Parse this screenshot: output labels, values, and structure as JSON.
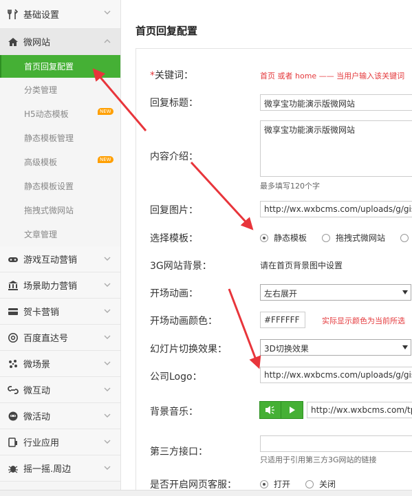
{
  "sidebar": {
    "groups_top": [
      {
        "label": "基础设置",
        "icon": "tools-icon"
      },
      {
        "label": "微网站",
        "icon": "home-icon"
      }
    ],
    "sub_items": [
      {
        "label": "首页回复配置",
        "active": true,
        "new": false
      },
      {
        "label": "分类管理",
        "active": false,
        "new": false
      },
      {
        "label": "H5动态模板",
        "active": false,
        "new": true
      },
      {
        "label": "静态模板管理",
        "active": false,
        "new": false
      },
      {
        "label": "高级模板",
        "active": false,
        "new": true
      },
      {
        "label": "静态模板设置",
        "active": false,
        "new": false
      },
      {
        "label": "拖拽式微网站",
        "active": false,
        "new": false
      },
      {
        "label": "文章管理",
        "active": false,
        "new": false
      }
    ],
    "new_badge": "NEW",
    "groups_bottom": [
      {
        "label": "游戏互动营销",
        "icon": "gamepad-icon"
      },
      {
        "label": "场景助力营销",
        "icon": "bank-icon"
      },
      {
        "label": "贺卡营销",
        "icon": "card-icon"
      },
      {
        "label": "百度直达号",
        "icon": "at-icon"
      },
      {
        "label": "微场景",
        "icon": "dots-icon"
      },
      {
        "label": "微互动",
        "icon": "chain-icon"
      },
      {
        "label": "微活动",
        "icon": "mascot-icon"
      },
      {
        "label": "行业应用",
        "icon": "device-icon"
      },
      {
        "label": "摇一摇.周边",
        "icon": "bug-icon"
      }
    ]
  },
  "main": {
    "page_title": "首页回复配置",
    "keyword": {
      "required_mark": "*",
      "label": "关键词：",
      "hint_keyword1": "首页",
      "hint_or": "或者",
      "hint_keyword2": "home",
      "hint_rest": "—— 当用户输入该关键词"
    },
    "reply_title": {
      "label": "回复标题：",
      "value": "微享宝功能演示版微网站"
    },
    "content_intro": {
      "label": "内容介绍：",
      "value": "微享宝功能演示版微网站",
      "hint": "最多填写120个字"
    },
    "reply_image": {
      "label": "回复图片：",
      "value": "http://wx.wxbcms.com/uploads/g/gisw"
    },
    "template": {
      "label": "选择模板：",
      "options": [
        "静态模板",
        "拖拽式微网站"
      ],
      "selected": "静态模板"
    },
    "bg_3g": {
      "label": "3G网站背景：",
      "text": "请在首页背景图中设置"
    },
    "opening_anim": {
      "label": "开场动画：",
      "value": "左右展开"
    },
    "opening_color": {
      "label": "开场动画颜色：",
      "value": "#FFFFFF",
      "hint": "实际显示颜色为当前所选"
    },
    "slide_effect": {
      "label": "幻灯片切换效果：",
      "value": "3D切换效果"
    },
    "company_logo": {
      "label": "公司Logo：",
      "value": "http://wx.wxbcms.com/uploads/g/gisw"
    },
    "bg_music": {
      "label": "背景音乐：",
      "value": "http://wx.wxbcms.com/tpl"
    },
    "third_party": {
      "label": "第三方接口：",
      "value": "",
      "hint": "只适用于引用第三方3G网站的链接"
    },
    "customer_service": {
      "label": "是否开启网页客服：",
      "options": [
        "打开",
        "关闭"
      ],
      "selected": "打开"
    }
  },
  "colors": {
    "accent": "#45b035",
    "annotation_red": "#e8353b",
    "required_red": "#e4393c"
  }
}
